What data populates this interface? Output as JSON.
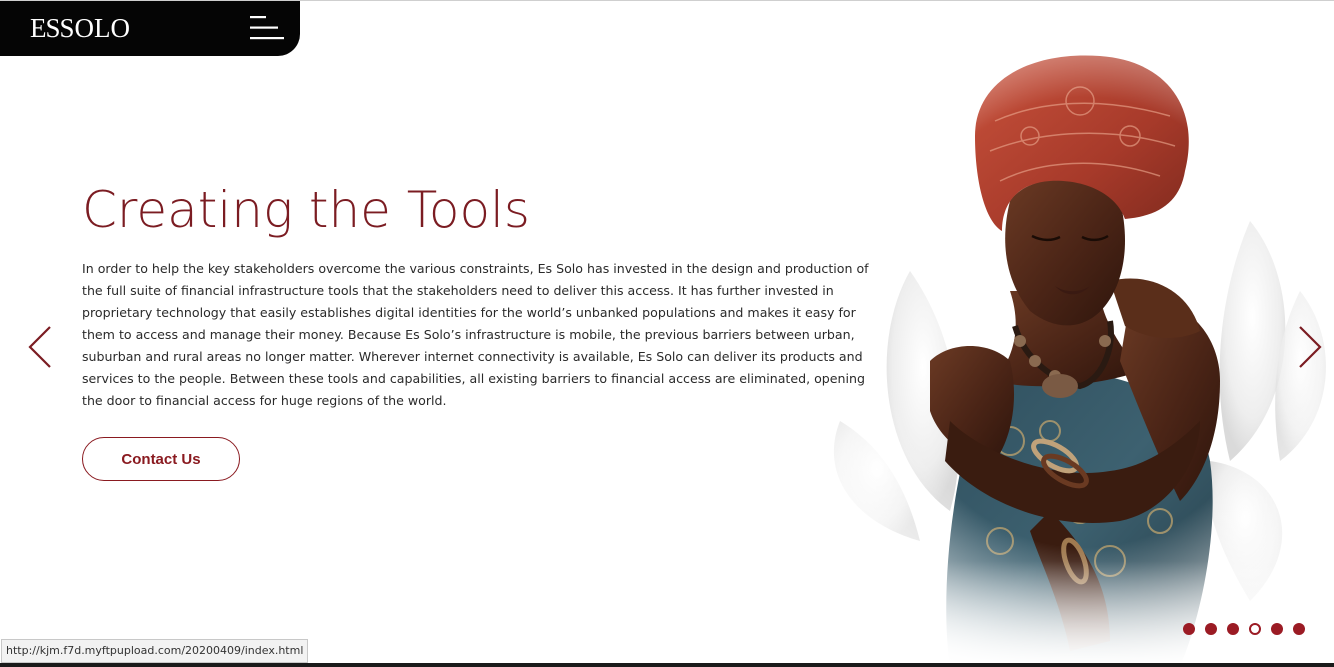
{
  "header": {
    "logo_es": "ES",
    "logo_solo": "SOLO",
    "menu_icon": "hamburger-menu-icon"
  },
  "hero": {
    "title": "Creating the Tools",
    "body": "In order to help the key stakeholders overcome the various constraints, Es Solo has invested in the design and production of the full suite of financial infrastructure tools that the stakeholders need to deliver this access. It has further invested in proprietary technology that easily establishes digital identities for the world’s unbanked populations and makes it easy for them to access and manage their money. Because Es Solo’s infrastructure is mobile, the previous barriers between urban, suburban and rural areas no longer matter. Wherever internet connectivity is available, Es Solo can deliver its products and services to the people. Between these tools and capabilities, all existing barriers to financial access are eliminated, opening the door to financial access for huge regions of the world.",
    "cta_label": "Contact Us",
    "image": "woman-in-red-headwrap-with-white-flower-petals"
  },
  "carousel": {
    "prev_icon": "chevron-left-icon",
    "next_icon": "chevron-right-icon",
    "slide_count": 6,
    "active_index": 3
  },
  "status_bar": {
    "url": "http://kjm.f7d.myftpupload.com/20200409/index.html"
  },
  "colors": {
    "brand": "#7b1c22",
    "accent": "#9b1b24",
    "header_bg": "#050505"
  }
}
